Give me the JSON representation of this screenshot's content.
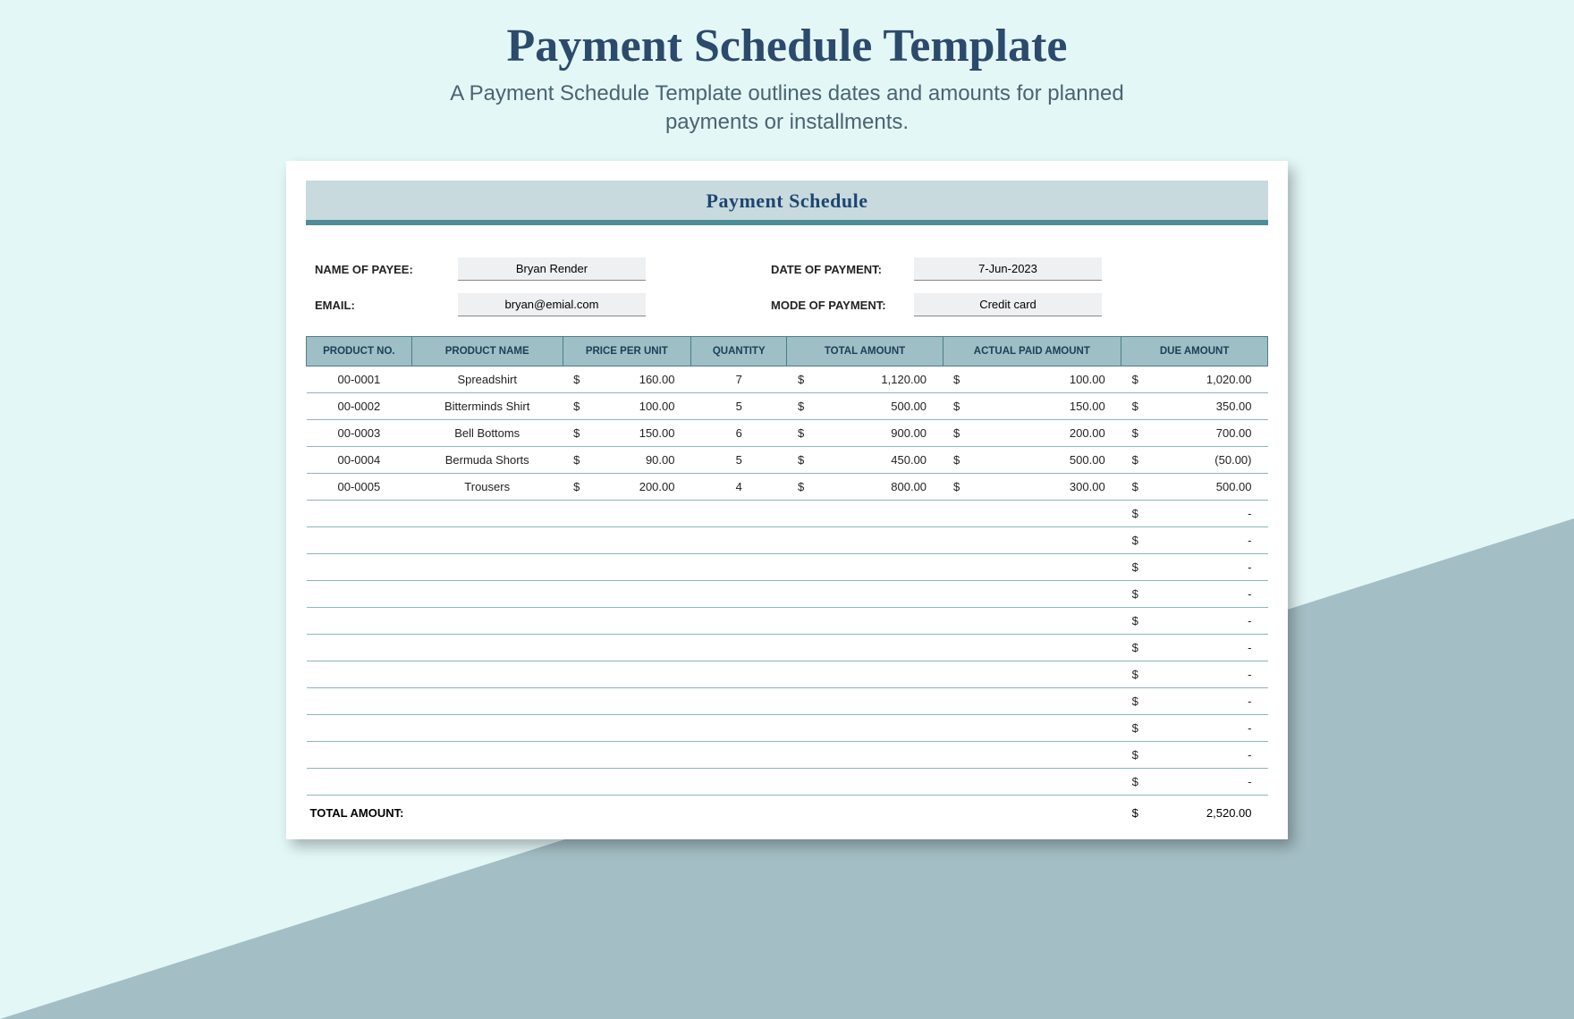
{
  "page": {
    "title": "Payment Schedule Template",
    "subtitle": "A Payment Schedule Template outlines dates and amounts for planned payments or installments."
  },
  "banner": {
    "title": "Payment Schedule"
  },
  "info": {
    "payee_label": "NAME OF PAYEE:",
    "payee_value": "Bryan Render",
    "email_label": "EMAIL:",
    "email_value": "bryan@emial.com",
    "date_label": "DATE OF PAYMENT:",
    "date_value": "7-Jun-2023",
    "mode_label": "MODE OF PAYMENT:",
    "mode_value": "Credit card"
  },
  "columns": {
    "product_no": "PRODUCT NO.",
    "product_name": "PRODUCT NAME",
    "price_per_unit": "PRICE PER UNIT",
    "quantity": "QUANTITY",
    "total_amount": "TOTAL AMOUNT",
    "actual_paid": "ACTUAL PAID AMOUNT",
    "due_amount": "DUE AMOUNT"
  },
  "currency": "$",
  "rows": [
    {
      "no": "00-0001",
      "name": "Spreadshirt",
      "ppu": "160.00",
      "qty": "7",
      "total": "1,120.00",
      "paid": "100.00",
      "due": "1,020.00"
    },
    {
      "no": "00-0002",
      "name": "Bitterminds Shirt",
      "ppu": "100.00",
      "qty": "5",
      "total": "500.00",
      "paid": "150.00",
      "due": "350.00"
    },
    {
      "no": "00-0003",
      "name": "Bell Bottoms",
      "ppu": "150.00",
      "qty": "6",
      "total": "900.00",
      "paid": "200.00",
      "due": "700.00"
    },
    {
      "no": "00-0004",
      "name": "Bermuda Shorts",
      "ppu": "90.00",
      "qty": "5",
      "total": "450.00",
      "paid": "500.00",
      "due": "(50.00)"
    },
    {
      "no": "00-0005",
      "name": "Trousers",
      "ppu": "200.00",
      "qty": "4",
      "total": "800.00",
      "paid": "300.00",
      "due": "500.00"
    }
  ],
  "empty_row_count": 11,
  "empty_dash": "-",
  "footer": {
    "total_label": "TOTAL AMOUNT:",
    "total_value": "2,520.00"
  }
}
